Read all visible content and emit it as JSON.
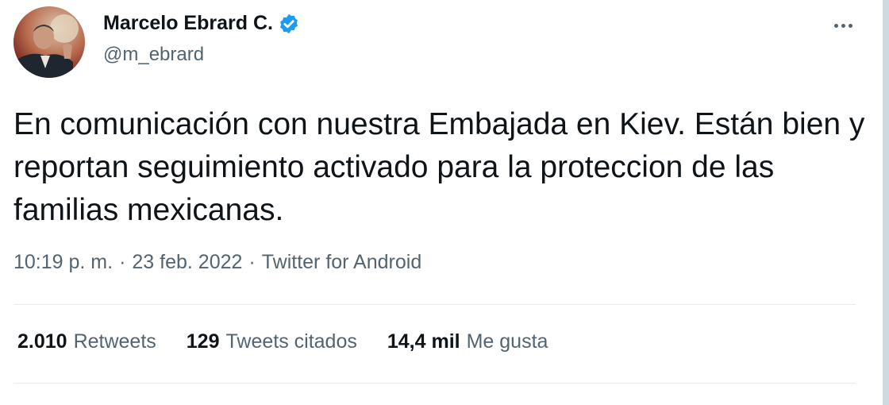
{
  "tweet": {
    "author": {
      "name": "Marcelo Ebrard C.",
      "handle": "@m_ebrard"
    },
    "text": "En comunicación con nuestra Embajada en Kiev. Están bien y reportan seguimiento activado para la proteccion de las familias mexicanas.",
    "time": "10:19 p. m.",
    "separator": "·",
    "date": "23 feb. 2022",
    "source": "Twitter for Android",
    "stats": [
      {
        "value": "2.010",
        "label": "Retweets"
      },
      {
        "value": "129",
        "label": "Tweets citados"
      },
      {
        "value": "14,4 mil",
        "label": "Me gusta"
      }
    ]
  },
  "icons": {
    "verified": "verified-badge-icon",
    "more": "more-options-icon"
  },
  "colors": {
    "text": "#0f1419",
    "secondary": "#536471",
    "verified": "#1d9bf0",
    "divider": "#e6ecf0"
  }
}
